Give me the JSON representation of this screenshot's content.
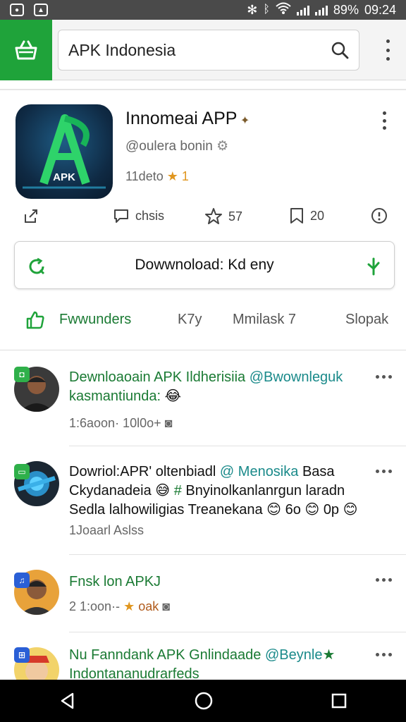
{
  "status_bar": {
    "battery": "89%",
    "time": "09:24"
  },
  "search": {
    "query": "APK Indonesia"
  },
  "app": {
    "title": "Innomeai APP",
    "developer": "@oulera bonin",
    "rating_text": "11deto",
    "rating_value": "1",
    "stats": {
      "comments": "chsis",
      "stars": "57",
      "saved": "20"
    }
  },
  "download_button": {
    "label": "Dowwnoload: Kd eny"
  },
  "tabs": [
    {
      "label": "Fwwunders",
      "active": true
    },
    {
      "label": "K7y"
    },
    {
      "label": "Mmilask 7"
    },
    {
      "label": "Slopak"
    }
  ],
  "posts": [
    {
      "line1_green": "Dewnloaoain APK Ildherisiia",
      "line1_teal": "@Bwownleguk",
      "line2_green": "kasmantiunda:",
      "meta": "1:6aoon· 10l0o+"
    },
    {
      "line1_black": "Dowriol:APR' oltenbiadl",
      "line1_teal": "@ Menosika",
      "line1_tail": "Basa",
      "line2": "Ckydanadeia",
      "line2_tail": "Bnyinolkanlanrgun laradn",
      "line3": "Sedla lalhowiligias Treanekana",
      "line3_a": "6o",
      "line3_b": "0p",
      "meta": "1Joaarl Aslss"
    },
    {
      "line1_green": "Fnsk lon APKJ",
      "meta": "2 1:oon·-",
      "meta_tail": "oak"
    },
    {
      "line1_green": "Nu Fanndank",
      "line1_mid": "APK Gnlindaade",
      "line1_teal": "@Beynle",
      "line2_green": "Indontananudrarfeds"
    }
  ],
  "colors": {
    "brand_green": "#1fa33a",
    "text_green": "#1a7a33",
    "mention_teal": "#1a8a8a",
    "star": "#e0961f"
  }
}
